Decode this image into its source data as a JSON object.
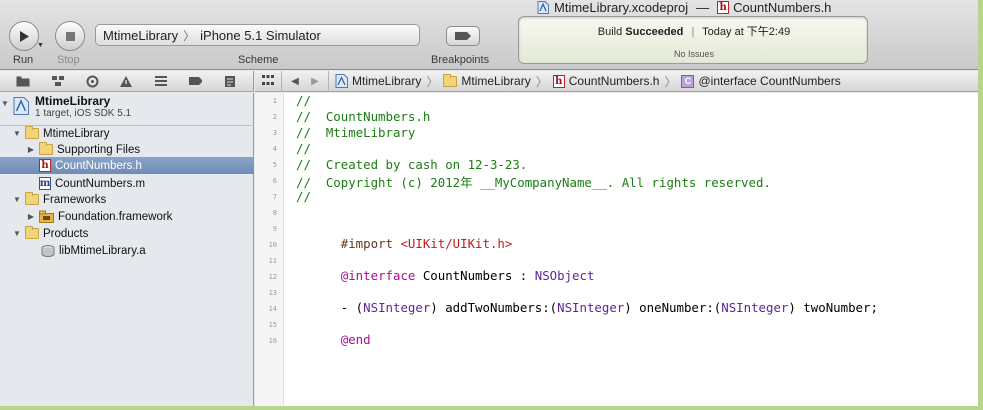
{
  "window": {
    "title_project": "MtimeLibrary.xcodeproj",
    "title_separator": "—",
    "title_file": "CountNumbers.h"
  },
  "toolbar": {
    "run_label": "Run",
    "stop_label": "Stop",
    "scheme_target": "MtimeLibrary",
    "scheme_destination": "iPhone 5.1 Simulator",
    "scheme_label": "Scheme",
    "breakpoints_label": "Breakpoints"
  },
  "activity": {
    "build_prefix": "Build",
    "build_status": "Succeeded",
    "timestamp": "Today at 下午2:49",
    "issues": "No Issues"
  },
  "jump_bar": {
    "crumbs": [
      "MtimeLibrary",
      "MtimeLibrary",
      "CountNumbers.h",
      "@interface CountNumbers"
    ]
  },
  "navigator": {
    "project_name": "MtimeLibrary",
    "project_sub": "1 target, iOS SDK 5.1",
    "items": [
      {
        "label": "MtimeLibrary"
      },
      {
        "label": "Supporting Files"
      },
      {
        "label": "CountNumbers.h"
      },
      {
        "label": "CountNumbers.m"
      },
      {
        "label": "Frameworks"
      },
      {
        "label": "Foundation.framework"
      },
      {
        "label": "Products"
      },
      {
        "label": "libMtimeLibrary.a"
      }
    ]
  },
  "editor": {
    "line_numbers": [
      "1",
      "2",
      "3",
      "4",
      "5",
      "6",
      "7",
      "8",
      "9",
      "10",
      "11",
      "12",
      "13",
      "14",
      "15",
      "16"
    ],
    "code": {
      "l1": "//",
      "l2": "//  CountNumbers.h",
      "l3": "//  MtimeLibrary",
      "l4": "//",
      "l5": "//  Created by cash on 12-3-23.",
      "l6": "//  Copyright (c) 2012年 __MyCompanyName__. All rights reserved.",
      "l7": "//",
      "l9_import": "#import",
      "l9_header": "<UIKit/UIKit.h>",
      "l11_kw": "@interface",
      "l11_name": " CountNumbers : ",
      "l11_super": "NSObject",
      "l13_a": "- (",
      "l13_t1": "NSInteger",
      "l13_b": ") addTwoNumbers:(",
      "l13_t2": "NSInteger",
      "l13_c": ") oneNumber:(",
      "l13_t3": "NSInteger",
      "l13_d": ") twoNumber;",
      "l15_kw": "@end"
    }
  },
  "colors": {
    "comment": "#1c7d12",
    "keyword": "#aa0d91",
    "class": "#5c2699",
    "string": "#c41a16",
    "preprocessor": "#643820",
    "selection": "#7590bb",
    "desktop": "#b7d68a"
  },
  "icons": [
    "run-icon",
    "stop-icon",
    "breakpoints-icon",
    "project-icon",
    "folder-icon",
    "header-file-icon",
    "implementation-file-icon",
    "framework-icon",
    "library-icon",
    "class-icon"
  ]
}
